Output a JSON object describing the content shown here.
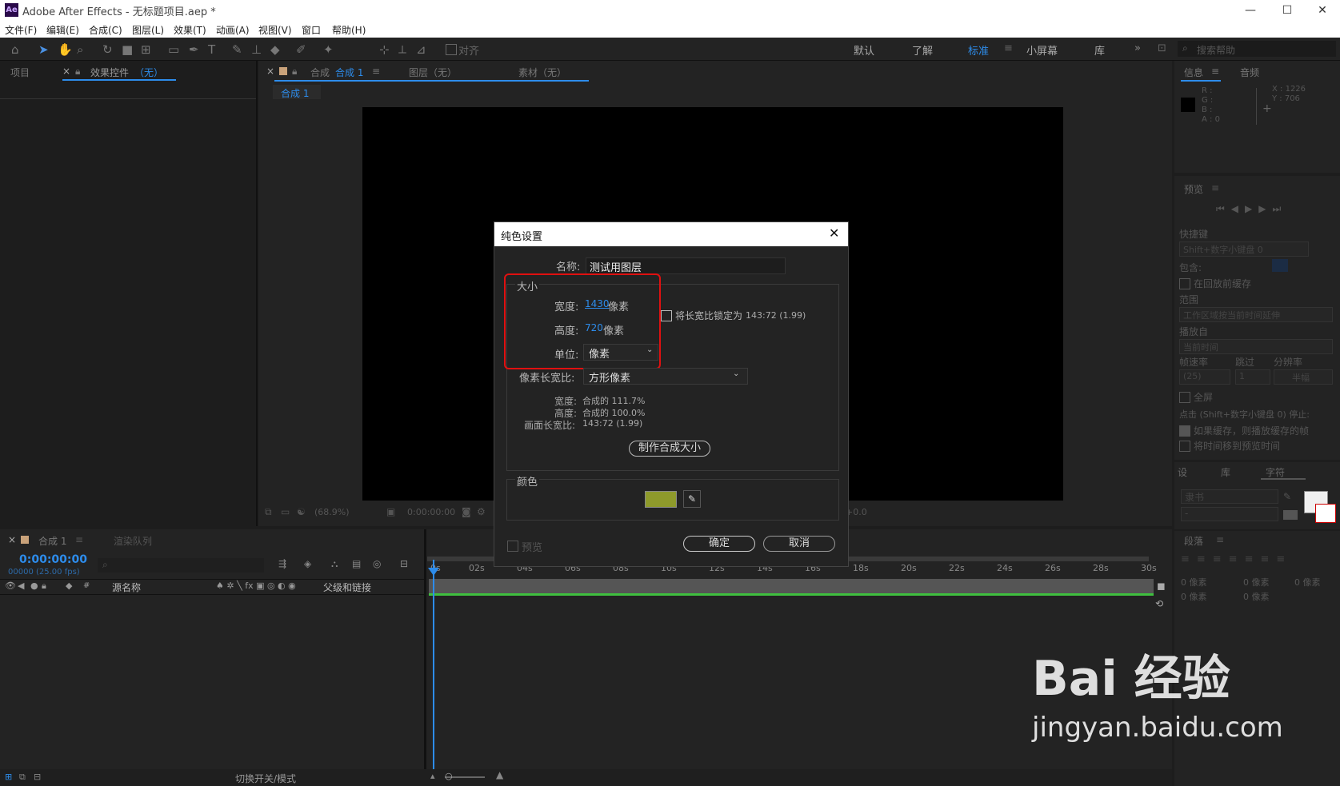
{
  "window": {
    "title": "Adobe After Effects - 无标题项目.aep *",
    "logo": "Ae"
  },
  "menu": [
    "文件(F)",
    "编辑(E)",
    "合成(C)",
    "图层(L)",
    "效果(T)",
    "动画(A)",
    "视图(V)",
    "窗口",
    "帮助(H)"
  ],
  "toolbar": {
    "align_label": "对齐",
    "workspaces": [
      "默认",
      "了解",
      "标准",
      "小屏幕",
      "库"
    ],
    "active_workspace": "标准",
    "search_placeholder": "搜索帮助",
    "more": "»"
  },
  "project_panel": {
    "tab_project": "项目",
    "tab_effects": "效果控件",
    "tab_effects_state": "（无）"
  },
  "comp_panel": {
    "tab_prefix": "合成",
    "tab_name": "合成 1",
    "tab_layer": "图层（无）",
    "tab_footage": "素材（无）",
    "sub_tab": "合成 1",
    "zoom": "(68.9%)",
    "time": "0:00:00:00",
    "exposure": "+0.0"
  },
  "info_panel": {
    "tab_info": "信息",
    "tab_audio": "音频",
    "r": "R :",
    "g": "G :",
    "b": "B :",
    "a": "A : 0",
    "x": "X : 1226",
    "y": "Y : 706"
  },
  "preview_panel": {
    "title": "预览",
    "shortcut_label": "快捷键",
    "shortcut_value": "Shift+数字小键盘 0",
    "include_label": "包含:",
    "cache_label": "在回放前缓存",
    "range_label": "范围",
    "range_value": "工作区域按当前时间延伸",
    "play_from_label": "播放自",
    "play_from_value": "当前时间",
    "fps_label": "帧速率",
    "skip_label": "跳过",
    "res_label": "分辨率",
    "fps_value": "(25)",
    "skip_value": "1",
    "res_value": "半幅",
    "fullscreen_label": "全屏",
    "stop_note": "点击 (Shift+数字小键盘 0) 停止:",
    "opt1": "如果缓存，则播放缓存的帧",
    "opt2": "将时间移到预览时间"
  },
  "char_panel": {
    "tab1": "设",
    "tab2": "库",
    "tab3": "字符",
    "font": "隶书",
    "style": "-",
    "para_title": "段落",
    "indent1": "0 像素",
    "indent2": "0 像素",
    "indent3": "0 像素",
    "indent4": "0 像素",
    "indent5": "0 像素"
  },
  "timeline": {
    "tab_comp": "合成 1",
    "tab_render": "渲染队列",
    "timecode": "0:00:00:00",
    "frames": "00000 (25.00 fps)",
    "col_source": "源名称",
    "col_parent": "父级和链接",
    "toggle_label": "切换开关/模式",
    "ruler": [
      "0s",
      "02s",
      "04s",
      "06s",
      "08s",
      "10s",
      "12s",
      "14s",
      "16s",
      "18s",
      "20s",
      "22s",
      "24s",
      "26s",
      "28s",
      "30s"
    ]
  },
  "dialog": {
    "title": "纯色设置",
    "name_label": "名称:",
    "name_value": "测试用图层",
    "size_group": "大小",
    "width_label": "宽度:",
    "width_value": "1430",
    "width_unit": "像素",
    "height_label": "高度:",
    "height_value": "720",
    "height_unit": "像素",
    "unit_label": "单位:",
    "unit_value": "像素",
    "lock_label": "将长宽比锁定为",
    "lock_value": "143:72 (1.99)",
    "par_label": "像素长宽比:",
    "par_value": "方形像素",
    "info_width_label": "宽度:",
    "info_width_value": "合成的 111.7%",
    "info_height_label": "高度:",
    "info_height_value": "合成的 100.0%",
    "info_frame_label": "画面长宽比:",
    "info_frame_value": "143:72 (1.99)",
    "make_comp_size": "制作合成大小",
    "color_group": "颜色",
    "color_hex": "#8e9a2b",
    "preview_label": "预览",
    "ok": "确定",
    "cancel": "取消"
  },
  "watermark": {
    "text": "Bai 经验",
    "url": "jingyan.baidu.com"
  },
  "colors": {
    "accent": "#2d8ceb",
    "highlight_box": "#e01010",
    "work_area": "#3fbf3f"
  }
}
